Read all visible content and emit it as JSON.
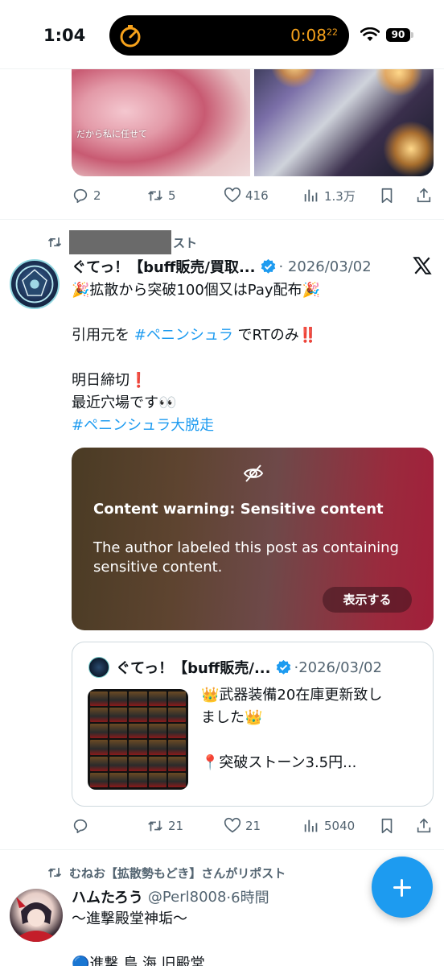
{
  "status_bar": {
    "time": "1:04",
    "timer": "0:08",
    "timer_fraction": "22",
    "battery": "90",
    "accent": "#f7a21b"
  },
  "tweet1": {
    "media_caption": "だから私に任せて",
    "replies": "2",
    "reposts": "5",
    "likes": "416",
    "views": "1.3万"
  },
  "tweet2": {
    "repost_suffix": "スト",
    "name": "ぐてっ！【buff販売/買取...",
    "date": "· 2026/03/02",
    "lines": [
      "🎉拡散から突破100個又はPay配布🎉",
      "",
      "引用元を ",
      "#ペニンシュラ",
      " でRTのみ‼️",
      "",
      "明日締切❗",
      "最近穴場です👀",
      "#ペニンシュラ大脱走"
    ],
    "content_warning": {
      "title": "Content warning: Sensitive content",
      "description": "The author labeled this post as containing sensitive content.",
      "show_button": "表示する"
    },
    "quote": {
      "name": "ぐてっ！【buff販売/...",
      "date": "2026/03/02",
      "line1": "👑武器装備20在庫更新致し",
      "line2": "ました👑",
      "line3": "📍突破ストーン3.5円..."
    },
    "replies": "",
    "reposts": "21",
    "likes": "21",
    "views": "5040"
  },
  "tweet3": {
    "repost_by": "むねお【拡散勢もどき】さんがリポスト",
    "name": "ハムたろう",
    "handle": "@Perl8008",
    "time": "·6時間",
    "line1": "〜進撃殿堂神垢〜",
    "line2": "🔵進撃 鳥 海 旧殿堂"
  },
  "colors": {
    "accent": "#1d9bf0",
    "muted": "#536471",
    "border": "#cfd9de"
  }
}
